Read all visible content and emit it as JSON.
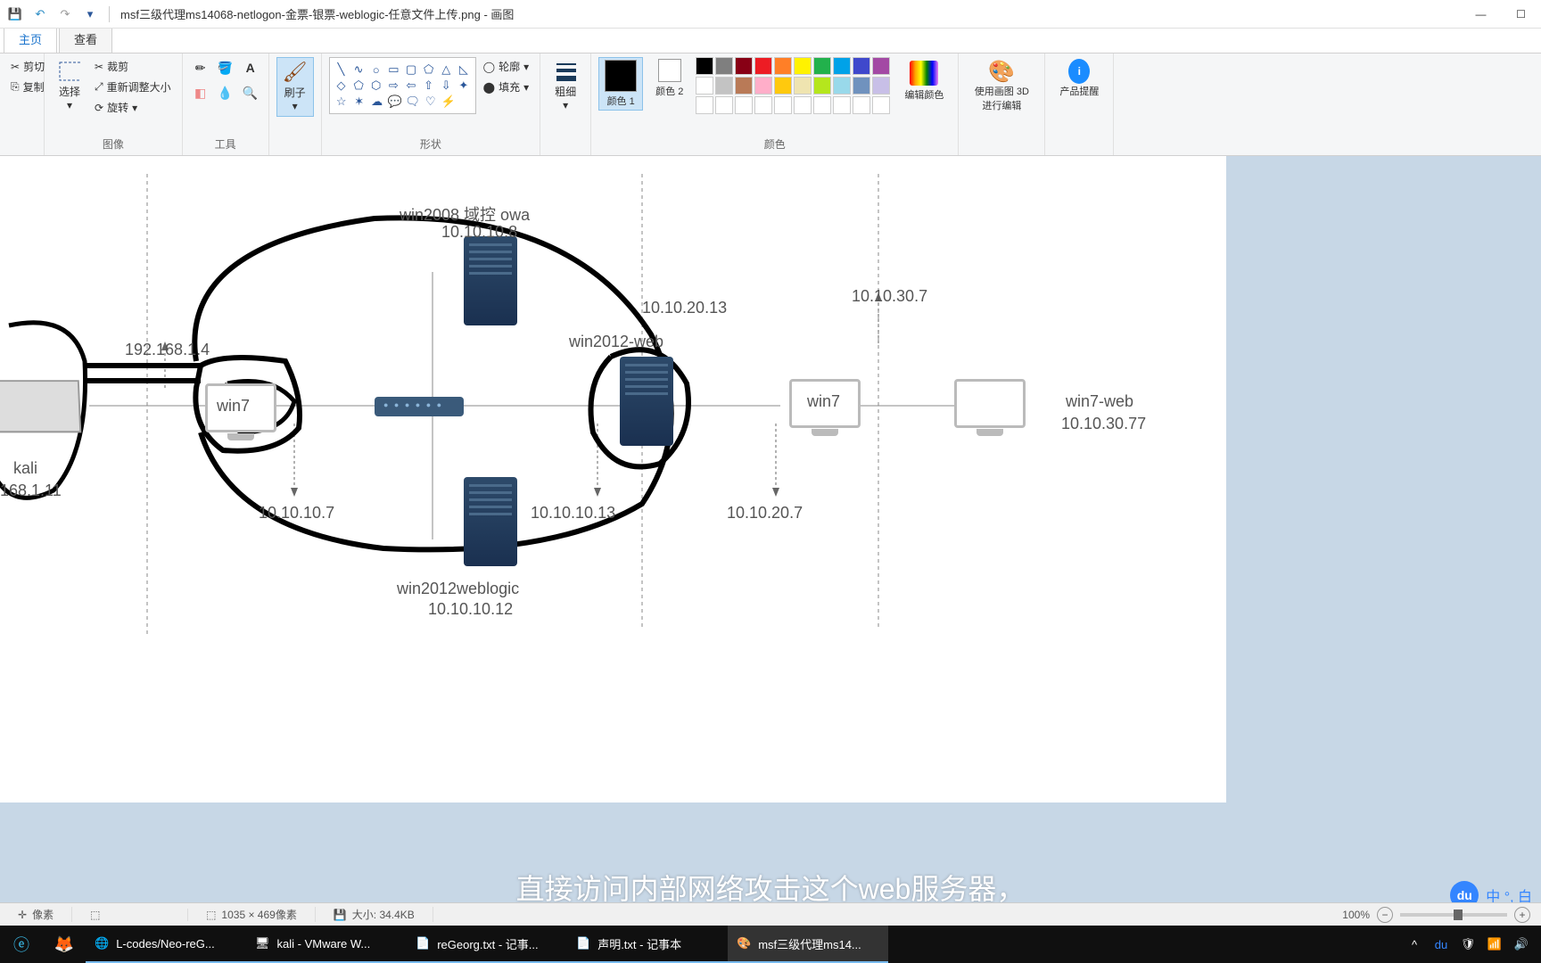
{
  "titlebar": {
    "title": "msf三级代理ms14068-netlogon-金票-银票-weblogic-任意文件上传.png - 画图"
  },
  "tabs": {
    "home": "主页",
    "view": "查看"
  },
  "ribbon": {
    "clipboard": {
      "cut": "剪切",
      "copy": "复制",
      "label": ""
    },
    "image": {
      "select": "选择",
      "crop": "裁剪",
      "resize": "重新调整大小",
      "rotate": "旋转",
      "label": "图像"
    },
    "tools": {
      "label": "工具"
    },
    "brush": {
      "name": "刷子"
    },
    "shapes": {
      "outline": "轮廓",
      "fill": "填充",
      "label": "形状"
    },
    "thickness": {
      "name": "粗细"
    },
    "colors": {
      "c1": "颜色 1",
      "c2": "颜色 2",
      "edit": "编辑颜色",
      "label": "颜色"
    },
    "paint3d": {
      "name": "使用画图 3D 进行编辑"
    },
    "alerts": {
      "name": "产品提醒"
    }
  },
  "diagram": {
    "kali_name": "kali",
    "kali_ip": "168.1.11",
    "win7_ip1": "192.168.1.4",
    "win7": "win7",
    "win7_ip2": "10.10.10.7",
    "dc_name": "win2008 域控 owa",
    "dc_ip": "10.10.10.8",
    "weblogic_name": "win2012weblogic",
    "weblogic_ip": "10.10.10.12",
    "web2012_name": "win2012-web",
    "web2012_ip1": "10.10.20.13",
    "web2012_ip2": "10.10.10.13",
    "win7_2": "win7",
    "win7_2_ip1": "10.10.30.7",
    "win7_2_ip2": "10.10.20.7",
    "win7web_name": "win7-web",
    "win7web_ip": "10.10.30.77"
  },
  "subtitle": "直接访问内部网络攻击这个web服务器，",
  "baidu": {
    "du": "du",
    "cn": "中 °, 白"
  },
  "statusbar": {
    "pos": "像素",
    "dim": "1035 × 469像素",
    "size": "大小: 34.4KB",
    "zoom": "100%"
  },
  "taskbar": {
    "chrome": "L-codes/Neo-reG...",
    "vmware": "kali - VMware W...",
    "notepad1": "reGeorg.txt - 记事...",
    "notepad2": "声明.txt - 记事本",
    "paint": "msf三级代理ms14..."
  },
  "colors": {
    "palette": [
      "#000",
      "#7f7f7f",
      "#880015",
      "#ed1c24",
      "#ff7f27",
      "#fff200",
      "#22b14c",
      "#00a2e8",
      "#3f48cc",
      "#a349a4",
      "#fff",
      "#c3c3c3",
      "#b97a57",
      "#ffaec9",
      "#ffc90e",
      "#efe4b0",
      "#b5e61d",
      "#99d9ea",
      "#7092be",
      "#c8bfe7"
    ]
  }
}
